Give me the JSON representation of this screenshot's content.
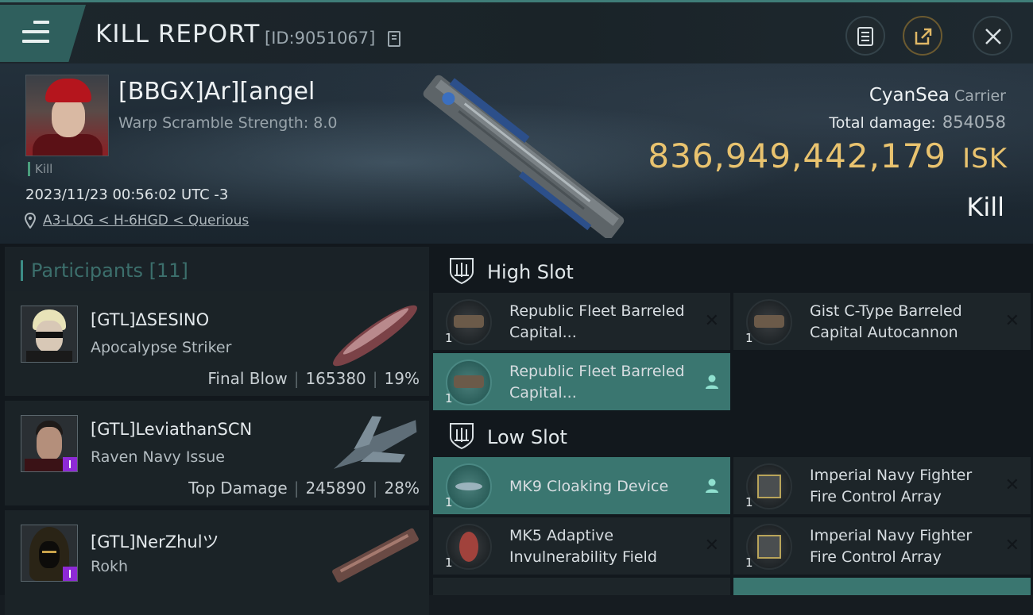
{
  "header": {
    "title": "KILL REPORT",
    "report_id": "[ID:9051067]",
    "icons": [
      "menu-icon",
      "copy-icon",
      "notes-icon",
      "share-icon",
      "close-icon"
    ]
  },
  "victim": {
    "name": "[BBGX]Ar][angel",
    "warp_scramble": "Warp Scramble Strength: 8.0",
    "tag": "Kill",
    "timestamp": "2023/11/23 00:56:02 UTC -3",
    "location": "A3-LOG < H-6HGD < Querious",
    "ship": "CyanSea",
    "ship_class": "Carrier",
    "total_damage_label": "Total damage:",
    "total_damage": "854058",
    "isk_value": "836,949,442,179",
    "isk_unit": "ISK",
    "result": "Kill"
  },
  "participants": {
    "label": "Participants",
    "count": "[11]",
    "items": [
      {
        "name": "[GTL]ΔSESINO",
        "ship": "Apocalypse Striker",
        "role": "Final Blow",
        "damage": "165380",
        "percent": "19%"
      },
      {
        "name": "[GTL]LeviathanSCN",
        "ship": "Raven Navy Issue",
        "role": "Top Damage",
        "damage": "245890",
        "percent": "28%"
      },
      {
        "name": "[GTL]NerZhulツ",
        "ship": "Rokh",
        "role": "",
        "damage": "",
        "percent": ""
      }
    ]
  },
  "fitting": {
    "high_slot_label": "High Slot",
    "low_slot_label": "Low Slot",
    "high": [
      {
        "name": "Republic Fleet Barreled Capital...",
        "qty": "1",
        "status": "destroyed"
      },
      {
        "name": "Gist C-Type Barreled Capital Autocannon",
        "qty": "1",
        "status": "destroyed"
      },
      {
        "name": "Republic Fleet Barreled Capital...",
        "qty": "1",
        "status": "dropped"
      }
    ],
    "low": [
      {
        "name": "MK9 Cloaking Device",
        "qty": "1",
        "status": "dropped"
      },
      {
        "name": "Imperial Navy Fighter Fire Control Array",
        "qty": "1",
        "status": "destroyed"
      },
      {
        "name": "MK5 Adaptive Invulnerability Field",
        "qty": "1",
        "status": "destroyed"
      },
      {
        "name": "Imperial Navy Fighter Fire Control Array",
        "qty": "1",
        "status": "destroyed"
      }
    ]
  },
  "colors": {
    "accent": "#3a7670",
    "isk": "#e9c36f",
    "purple_badge": "#8e2ad6"
  }
}
